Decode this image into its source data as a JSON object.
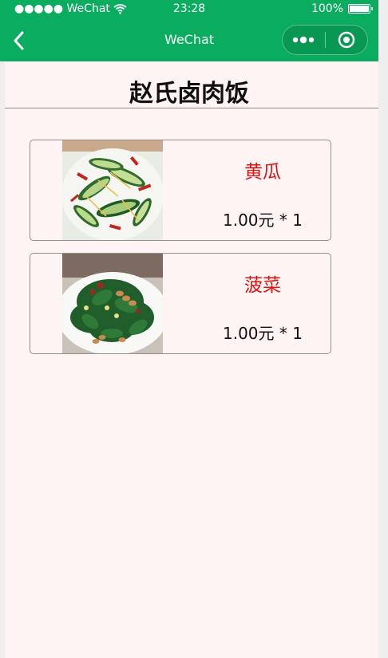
{
  "status_bar": {
    "carrier": "●●●●● WeChat",
    "time": "23:28",
    "battery": "100%"
  },
  "nav": {
    "title": "WeChat"
  },
  "page": {
    "title": "赵氏卤肉饭"
  },
  "items": [
    {
      "name": "黄瓜",
      "price": "1.00元 * 1",
      "image": "cucumber-salad-photo"
    },
    {
      "name": "菠菜",
      "price": "1.00元 * 1",
      "image": "spinach-peanut-photo"
    }
  ],
  "colors": {
    "nav_green": "#0aad5f",
    "page_bg": "#fff4f4",
    "item_name_red": "#e01212"
  }
}
